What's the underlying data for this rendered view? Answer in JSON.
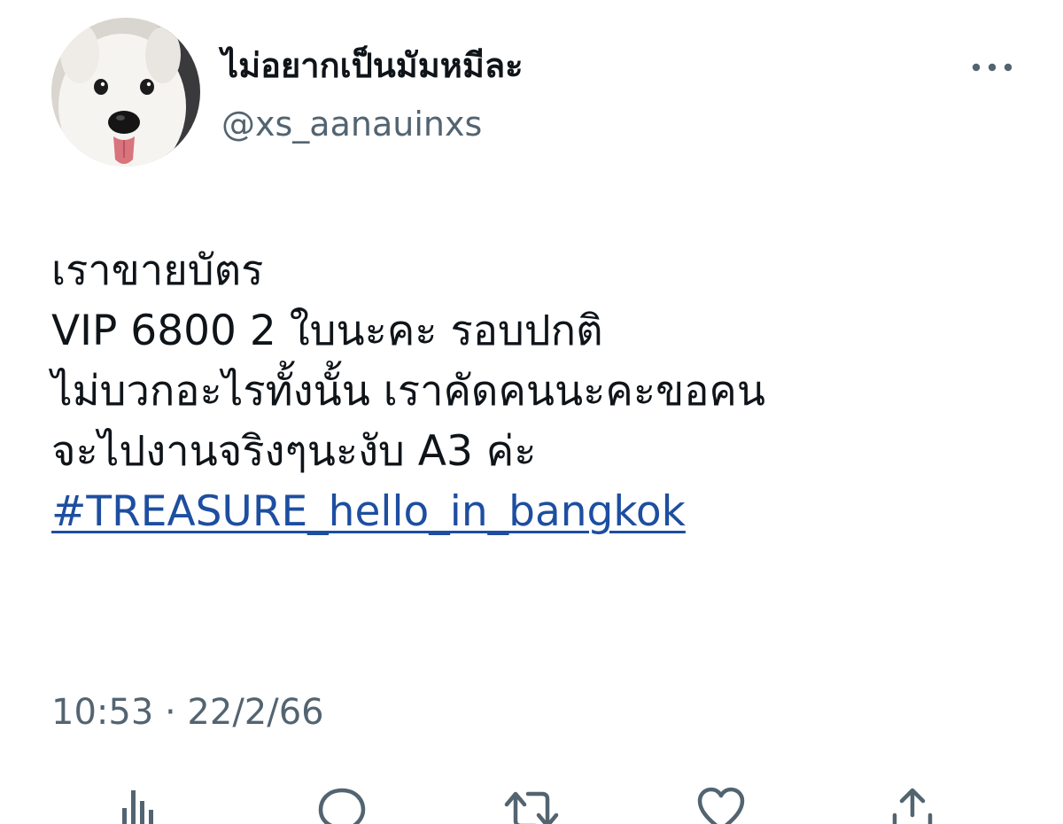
{
  "user": {
    "display_name": "ไม่อยากเป็นมัมหมีละ",
    "handle": "@xs_aanauinxs"
  },
  "tweet": {
    "lines": [
      "เราขายบัตร",
      "VIP 6800 2  ใบนะคะ รอบปกติ",
      "ไม่บวกอะไรทั้งนั้น เราคัดคนนะคะขอคน",
      "จะไปงานจริงๆนะงับ A3 ค่ะ"
    ],
    "hashtag": "#TREASURE_hello_in_bangkok"
  },
  "timestamp": "10:53 · 22/2/66",
  "icons": {
    "more": "more-horizontal-icon",
    "analytics": "analytics-icon",
    "reply": "reply-icon",
    "retweet": "retweet-icon",
    "like": "heart-icon",
    "share": "share-icon"
  },
  "colors": {
    "text": "#0f1419",
    "secondary": "#536471",
    "link": "#1d4ea0"
  }
}
